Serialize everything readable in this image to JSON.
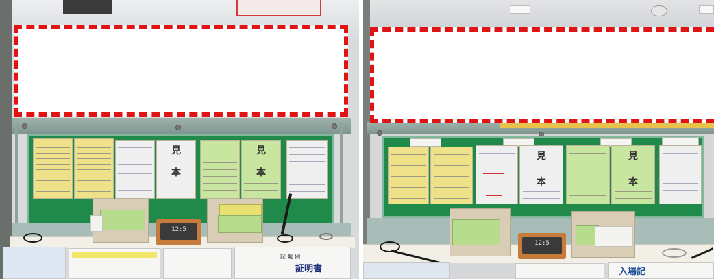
{
  "photos": [
    {
      "side": "left",
      "redaction": true,
      "notice_glyphs": [
        "見",
        "本",
        "見",
        "本"
      ],
      "clock_display": "12:5",
      "desk_text_lines": [
        "記 載 例",
        "証明書"
      ]
    },
    {
      "side": "right",
      "redaction": true,
      "notice_glyphs": [
        "見",
        "本",
        "見",
        "本"
      ],
      "clock_display": "12:5",
      "desk_text_lines": [
        "入場記"
      ]
    }
  ],
  "colors": {
    "redaction_border": "#e01414",
    "board_green": "#1f8a4a",
    "notice_yellow": "#efe08a",
    "notice_green": "#c9e6a0",
    "clock_body": "#c67a3c"
  }
}
